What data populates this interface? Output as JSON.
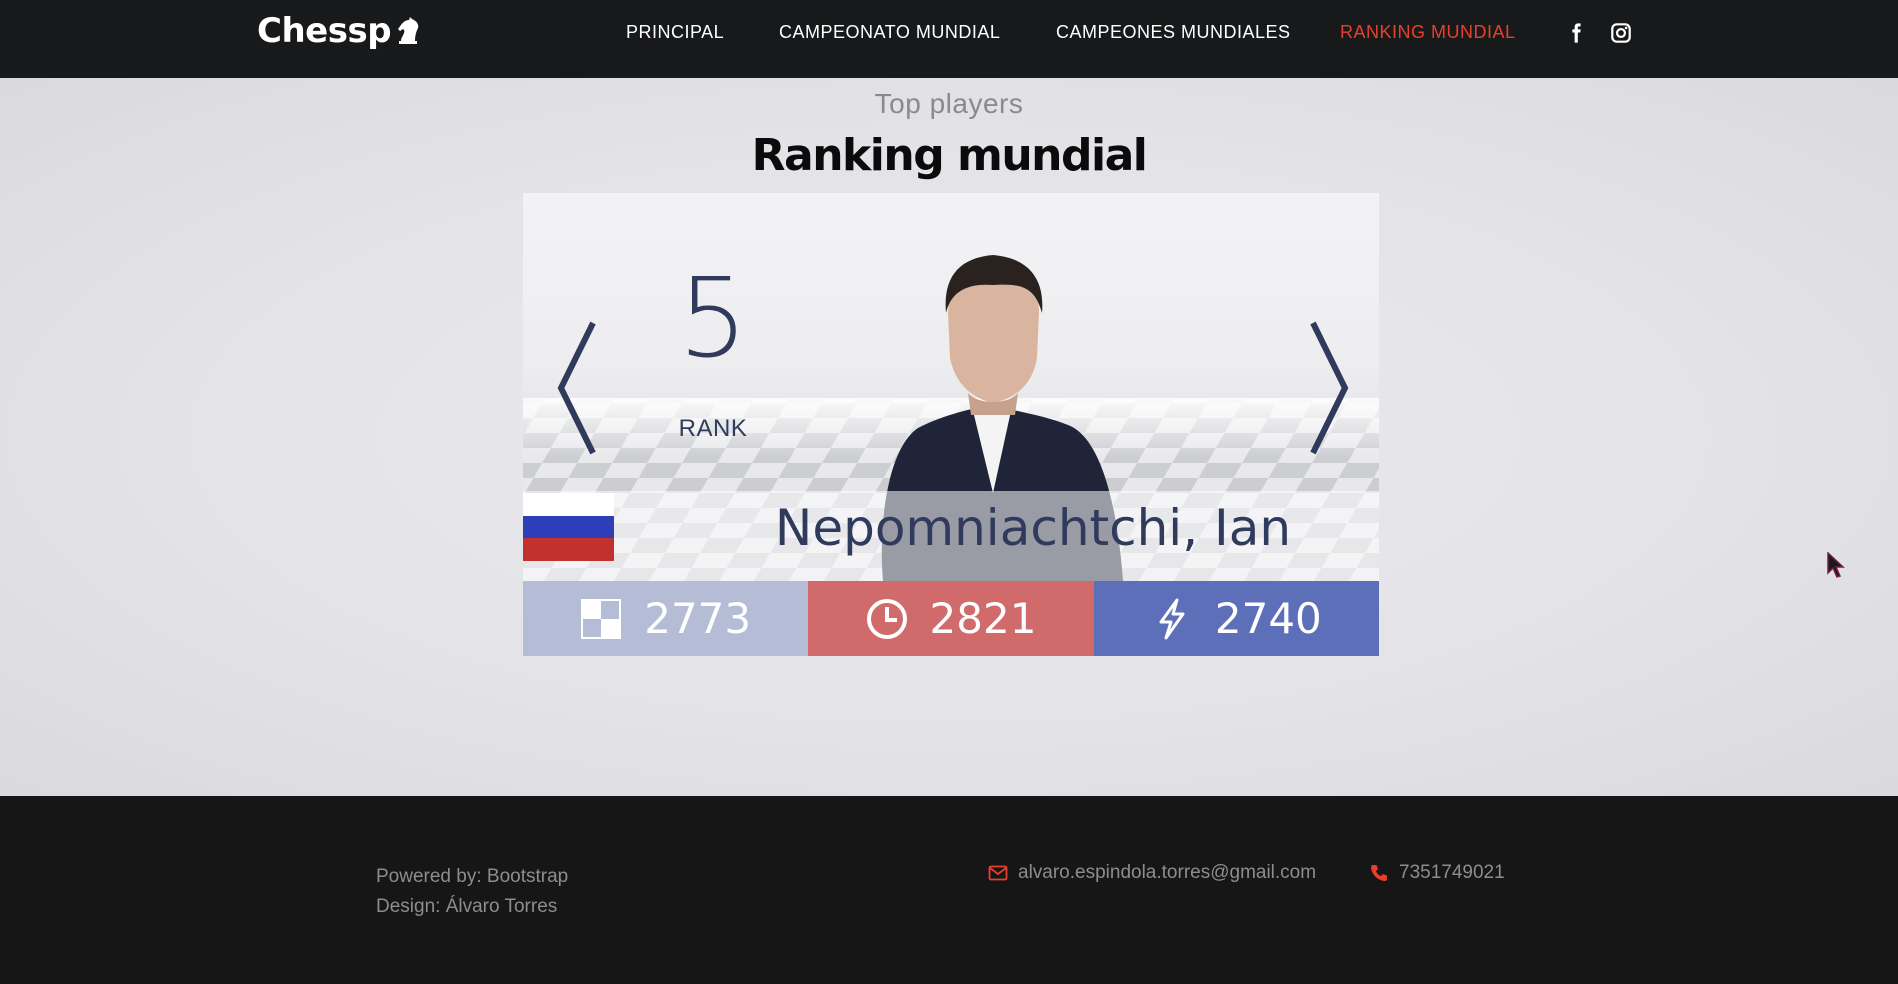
{
  "navbar": {
    "brand": "Chessp",
    "links": [
      {
        "label": "PRINCIPAL",
        "active": false
      },
      {
        "label": "CAMPEONATO MUNDIAL",
        "active": false
      },
      {
        "label": "CAMPEONES MUNDIALES",
        "active": false
      },
      {
        "label": "RANKING MUNDIAL",
        "active": true
      }
    ],
    "social": [
      "facebook-icon",
      "instagram-icon"
    ]
  },
  "main": {
    "eyebrow": "Top players",
    "title": "Ranking mundial"
  },
  "player_card": {
    "rank": "5",
    "rank_label": "RANK",
    "name": "Nepomniachtchi, Ian",
    "flag": "russia-flag",
    "stats": [
      {
        "icon": "standard-board-icon",
        "value": "2773",
        "color": "#b4bdd5"
      },
      {
        "icon": "clock-icon",
        "value": "2821",
        "color": "#d06a6b"
      },
      {
        "icon": "lightning-icon",
        "value": "2740",
        "color": "#5d6fb8"
      }
    ]
  },
  "footer": {
    "powered_by": "Powered by: Bootstrap",
    "design": "Design: Álvaro Torres",
    "email": "alvaro.espindola.torres@gmail.com",
    "phone": "7351749021"
  },
  "colors": {
    "accent": "#e8402b",
    "navbar_bg": "#18191b",
    "footer_bg": "#161617",
    "rank_text": "#2f3a5c"
  }
}
